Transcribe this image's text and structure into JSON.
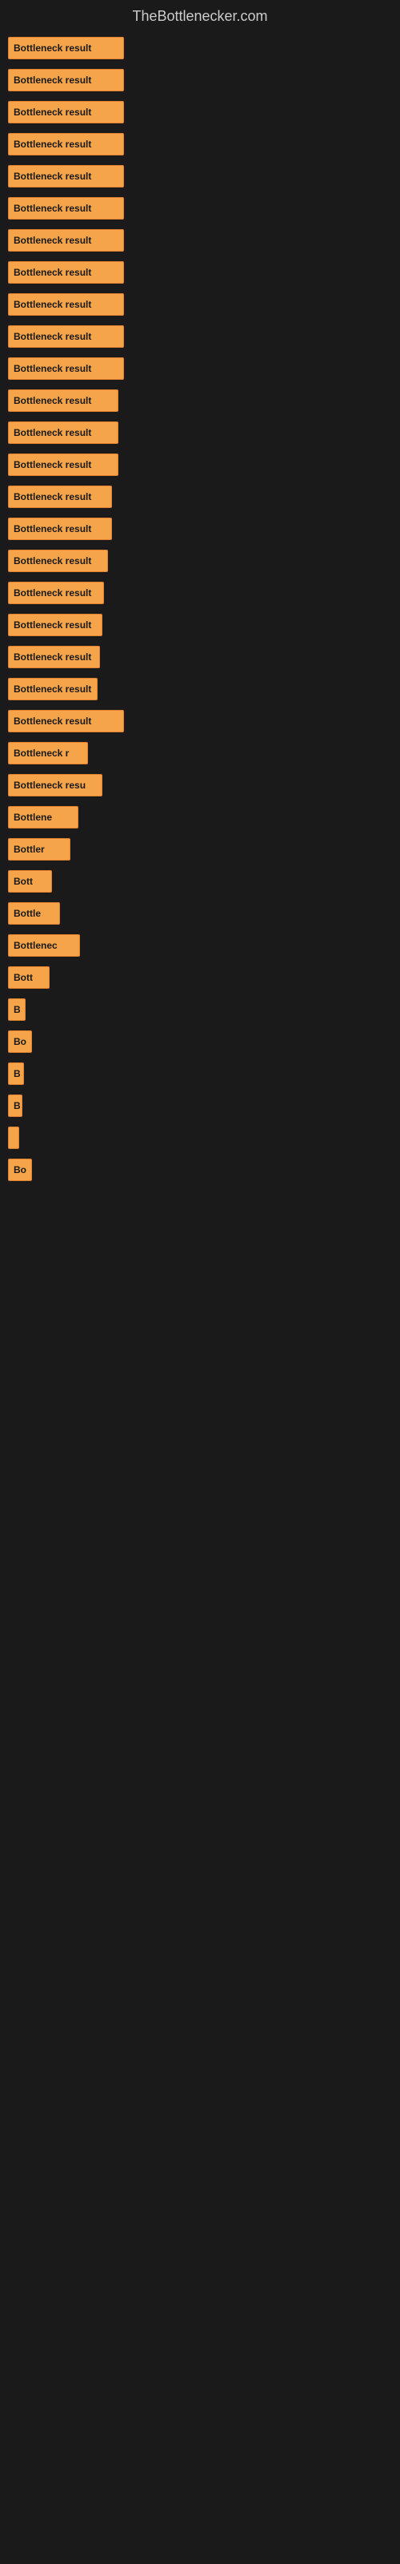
{
  "site": {
    "title": "TheBottlenecker.com"
  },
  "bars": [
    {
      "label": "Bottleneck result",
      "width": 145
    },
    {
      "label": "Bottleneck result",
      "width": 145
    },
    {
      "label": "Bottleneck result",
      "width": 145
    },
    {
      "label": "Bottleneck result",
      "width": 145
    },
    {
      "label": "Bottleneck result",
      "width": 145
    },
    {
      "label": "Bottleneck result",
      "width": 145
    },
    {
      "label": "Bottleneck result",
      "width": 145
    },
    {
      "label": "Bottleneck result",
      "width": 145
    },
    {
      "label": "Bottleneck result",
      "width": 145
    },
    {
      "label": "Bottleneck result",
      "width": 145
    },
    {
      "label": "Bottleneck result",
      "width": 145
    },
    {
      "label": "Bottleneck result",
      "width": 138
    },
    {
      "label": "Bottleneck result",
      "width": 138
    },
    {
      "label": "Bottleneck result",
      "width": 138
    },
    {
      "label": "Bottleneck result",
      "width": 130
    },
    {
      "label": "Bottleneck result",
      "width": 130
    },
    {
      "label": "Bottleneck result",
      "width": 125
    },
    {
      "label": "Bottleneck result",
      "width": 120
    },
    {
      "label": "Bottleneck result",
      "width": 118
    },
    {
      "label": "Bottleneck result",
      "width": 115
    },
    {
      "label": "Bottleneck result",
      "width": 112
    },
    {
      "label": "Bottleneck result",
      "width": 145
    },
    {
      "label": "Bottleneck r",
      "width": 100
    },
    {
      "label": "Bottleneck resu",
      "width": 118
    },
    {
      "label": "Bottlene",
      "width": 88
    },
    {
      "label": "Bottler",
      "width": 78
    },
    {
      "label": "Bott",
      "width": 55
    },
    {
      "label": "Bottle",
      "width": 65
    },
    {
      "label": "Bottlenec",
      "width": 90
    },
    {
      "label": "Bott",
      "width": 52
    },
    {
      "label": "B",
      "width": 22
    },
    {
      "label": "Bo",
      "width": 30
    },
    {
      "label": "B",
      "width": 20
    },
    {
      "label": "B",
      "width": 18
    },
    {
      "label": "",
      "width": 12
    },
    {
      "label": "Bo",
      "width": 30
    }
  ]
}
